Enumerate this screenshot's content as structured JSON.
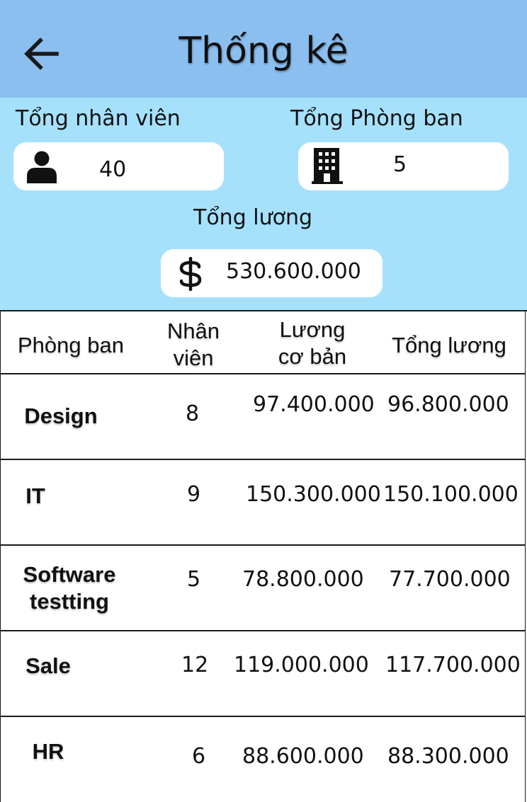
{
  "header": {
    "title": "Thống kê",
    "back_icon": "arrow-left-icon"
  },
  "summary": {
    "employees": {
      "label": "Tổng nhân viên",
      "value": "40",
      "icon": "person-icon"
    },
    "departments": {
      "label": "Tổng Phòng ban",
      "value": "5",
      "icon": "building-icon"
    },
    "salary": {
      "label": "Tổng lương",
      "value": "530.600.000",
      "icon": "dollar-icon"
    }
  },
  "table": {
    "headers": {
      "department": "Phòng ban",
      "employees_line1": "Nhân",
      "employees_line2": "viên",
      "base_salary_line1": "Lương",
      "base_salary_line2": "cơ bản",
      "total_salary": "Tổng lương"
    },
    "rows": [
      {
        "department": "Design",
        "employees": "8",
        "base_salary": "97.400.000",
        "total_salary": "96.800.000"
      },
      {
        "department": "IT",
        "employees": "9",
        "base_salary": "150.300.000",
        "total_salary": "150.100.000"
      },
      {
        "department": "Software testting",
        "employees": "5",
        "base_salary": "78.800.000",
        "total_salary": "77.700.000"
      },
      {
        "department": "Sale",
        "employees": "12",
        "base_salary": "119.000.000",
        "total_salary": "117.700.000"
      },
      {
        "department": "HR",
        "employees": "6",
        "base_salary": "88.600.000",
        "total_salary": "88.300.000"
      }
    ]
  },
  "colors": {
    "header_bg": "#8bbff0",
    "summary_bg": "#a6e1fc",
    "card_bg": "#ffffff"
  }
}
